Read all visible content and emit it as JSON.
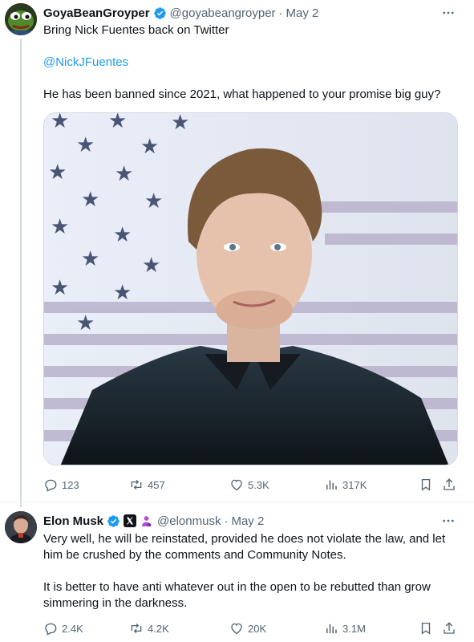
{
  "tweets": [
    {
      "display_name": "GoyaBeanGroyper",
      "handle": "@goyabeangroyper",
      "separator": "·",
      "date": "May 2",
      "line1": "Bring Nick Fuentes back on Twitter",
      "mention": "@NickJFuentes",
      "line3": "He has been banned since 2021, what happened to your promise big guy?",
      "stats": {
        "replies": "123",
        "reposts": "457",
        "likes": "5.3K",
        "views": "317K"
      }
    },
    {
      "display_name": "Elon Musk",
      "handle": "@elonmusk",
      "separator": "·",
      "date": "May 2",
      "paragraph1": "Very well, he will be reinstated, provided he does not violate the law, and let him be crushed by the comments and Community Notes.",
      "paragraph2": "It is better to have anti whatever out in the open to be rebutted than grow simmering in the darkness.",
      "stats": {
        "replies": "2.4K",
        "reposts": "4.2K",
        "likes": "20K",
        "views": "3.1M"
      }
    }
  ],
  "colors": {
    "verified": "#1d9bf0",
    "link": "#1d9bf0",
    "muted": "#536471",
    "affiliate_badge": "#b04bd6"
  },
  "icons": [
    "more-icon",
    "reply-icon",
    "repost-icon",
    "like-icon",
    "views-icon",
    "bookmark-icon",
    "share-icon",
    "verified-icon",
    "x-logo-icon",
    "affiliate-icon"
  ]
}
